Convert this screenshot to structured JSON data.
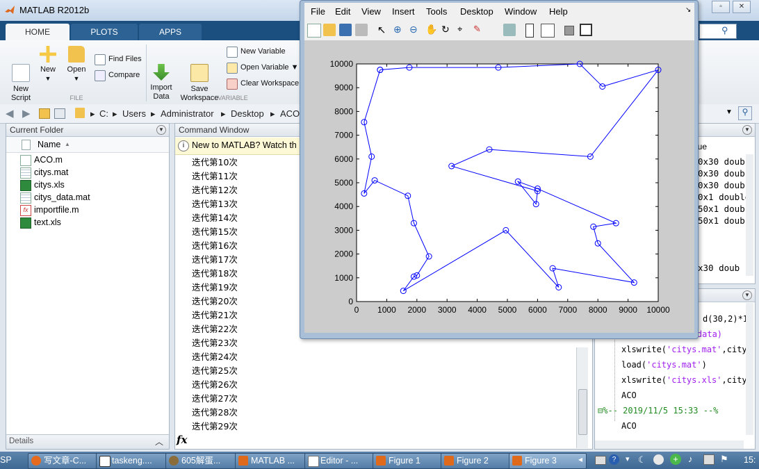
{
  "app": {
    "title": "MATLAB R2012b"
  },
  "ribbon": {
    "tabs": [
      "HOME",
      "PLOTS",
      "APPS"
    ],
    "new_script": "New\nScript",
    "new": "New",
    "open": "Open",
    "find_files": "Find Files",
    "compare": "Compare",
    "import_data": "Import\nData",
    "save_workspace": "Save\nWorkspace",
    "new_variable": "New Variable",
    "open_variable": "Open Variable",
    "clear_workspace": "Clear Workspace",
    "section_file": "FILE",
    "section_variable": "VARIABLE"
  },
  "address": {
    "crumbs": [
      "C:",
      "Users",
      "Administrator",
      "Desktop",
      "ACO"
    ]
  },
  "current_folder": {
    "title": "Current Folder",
    "column": "Name",
    "files": [
      {
        "name": "ACO.m",
        "icon": "m-file-icon"
      },
      {
        "name": "citys.mat",
        "icon": "mat-file-icon"
      },
      {
        "name": "citys.xls",
        "icon": "excel-file-icon"
      },
      {
        "name": "citys_data.mat",
        "icon": "mat-file-icon"
      },
      {
        "name": "importfile.m",
        "icon": "function-file-icon"
      },
      {
        "name": "text.xls",
        "icon": "excel-file-icon"
      }
    ],
    "details": "Details"
  },
  "command_window": {
    "title": "Command Window",
    "notice": "New to MATLAB? Watch th",
    "lines": [
      "迭代第10次",
      "迭代第11次",
      "迭代第12次",
      "迭代第13次",
      "迭代第14次",
      "迭代第15次",
      "迭代第16次",
      "迭代第17次",
      "迭代第18次",
      "迭代第19次",
      "迭代第20次",
      "迭代第21次",
      "迭代第22次",
      "迭代第23次",
      "迭代第24次",
      "迭代第25次",
      "迭代第26次",
      "迭代第27次",
      "迭代第28次",
      "迭代第29次"
    ],
    "prompt": "fx"
  },
  "workspace": {
    "header": "lue",
    "values": [
      "0x30 doub",
      "0x30 doub",
      "0x30 doub",
      "0x1 double",
      "50x1 doub",
      "50x1 doub",
      "x30 doub"
    ]
  },
  "history": {
    "lines": [
      "d(30,2)*1",
      "ls',data)",
      "xlswrite('citys.mat',city",
      "load('citys.mat')",
      "xlswrite('citys.xls',city",
      "ACO",
      "%-- 2019/11/5 15:33 --%",
      "ACO"
    ]
  },
  "figure": {
    "menus": [
      "File",
      "Edit",
      "View",
      "Insert",
      "Tools",
      "Desktop",
      "Window",
      "Help"
    ]
  },
  "chart_data": {
    "type": "line",
    "title": "",
    "xlabel": "",
    "ylabel": "",
    "xlim": [
      0,
      10000
    ],
    "ylim": [
      0,
      10000
    ],
    "xticks": [
      0,
      1000,
      2000,
      3000,
      4000,
      5000,
      6000,
      7000,
      8000,
      9000,
      10000
    ],
    "yticks": [
      0,
      1000,
      2000,
      3000,
      4000,
      5000,
      6000,
      7000,
      8000,
      9000,
      10000
    ],
    "grid": false,
    "color": "#0000ff",
    "marker": "circle",
    "x": [
      780,
      1750,
      4700,
      7400,
      8150,
      10000,
      7750,
      4400,
      3150,
      6000,
      5950,
      5350,
      6000,
      8600,
      7850,
      8000,
      9200,
      6500,
      6700,
      4950,
      1550,
      1900,
      2000,
      2400,
      1900,
      1700,
      600,
      250,
      500,
      250,
      780
    ],
    "y": [
      9750,
      9850,
      9850,
      10000,
      9050,
      9750,
      6100,
      6400,
      5700,
      4650,
      4100,
      5050,
      4750,
      3300,
      3150,
      2450,
      800,
      1400,
      600,
      3000,
      450,
      1050,
      1100,
      1900,
      3300,
      4450,
      5100,
      4550,
      6100,
      7550,
      9750
    ]
  },
  "taskbar": {
    "items": [
      "写文章-C...",
      "taskeng....",
      "605解蛋...",
      "MATLAB ...",
      "Editor - ...",
      "Figure 1",
      "Figure 2",
      "Figure 3"
    ],
    "left_clip": "SP",
    "clock": "15:"
  },
  "colors": {
    "ribbon_tab_bar": "#1b4f80",
    "plot_line": "#0000ff",
    "figure_bg": "#cccccc"
  }
}
